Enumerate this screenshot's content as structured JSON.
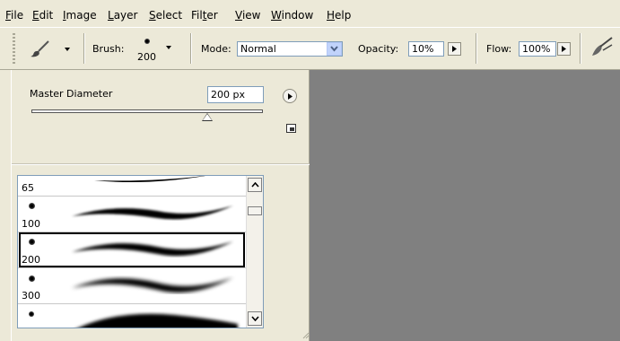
{
  "menu": [
    {
      "pre": "",
      "ul": "F",
      "post": "ile"
    },
    {
      "pre": "",
      "ul": "E",
      "post": "dit"
    },
    {
      "pre": "",
      "ul": "I",
      "post": "mage"
    },
    {
      "pre": "",
      "ul": "L",
      "post": "ayer"
    },
    {
      "pre": "",
      "ul": "S",
      "post": "elect"
    },
    {
      "pre": "Fil",
      "ul": "t",
      "post": "er"
    },
    {
      "pre": "",
      "ul": "V",
      "post": "iew"
    },
    {
      "pre": "",
      "ul": "W",
      "post": "indow"
    },
    {
      "pre": "",
      "ul": "H",
      "post": "elp"
    }
  ],
  "options": {
    "brush_label": "Brush:",
    "brush_size": "200",
    "mode_label": "Mode:",
    "mode_value": "Normal",
    "opacity_label": "Opacity:",
    "opacity_value": "10%",
    "flow_label": "Flow:",
    "flow_value": "100%"
  },
  "panel": {
    "master_diameter_label": "Master Diameter",
    "master_diameter_value": "200 px",
    "slider_fraction": 0.76
  },
  "brushes": [
    {
      "size": "65"
    },
    {
      "size": "100"
    },
    {
      "size": "200",
      "selected": true
    },
    {
      "size": "300"
    },
    {
      "size": ""
    }
  ],
  "icons": {
    "tool_preset": "brush-icon",
    "airbrush": "airbrush-icon",
    "panel_menu": "arrow-right-icon",
    "new_preset": "new-preset-icon"
  },
  "colors": {
    "canvas": "#808080",
    "chrome": "#ece9d8",
    "select_button": "#c1d3fb"
  }
}
